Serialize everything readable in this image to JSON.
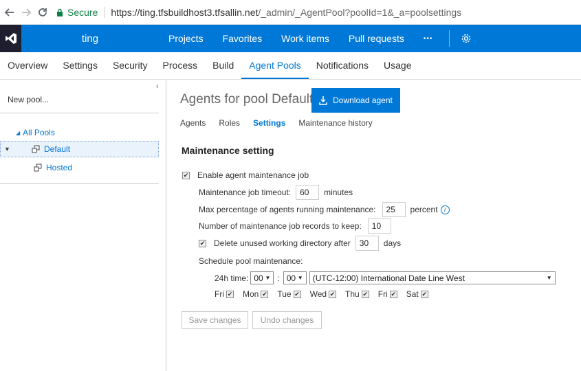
{
  "browser": {
    "secure_label": "Secure",
    "url_host": "https://ting.tfsbuildhost3.tfsallin.net",
    "url_path": "/_admin/_AgentPool?poolId=1&_a=poolsettings"
  },
  "topnav": {
    "project": "ting",
    "items": [
      "Projects",
      "Favorites",
      "Work items",
      "Pull requests",
      "•••"
    ]
  },
  "admin_tabs": [
    "Overview",
    "Settings",
    "Security",
    "Process",
    "Build",
    "Agent Pools",
    "Notifications",
    "Usage"
  ],
  "left": {
    "new_pool": "New pool...",
    "all_pools": "All Pools",
    "pools": [
      "Default",
      "Hosted"
    ]
  },
  "main": {
    "title": "Agents for pool Default",
    "download_label": "Download agent",
    "subtabs": [
      "Agents",
      "Roles",
      "Settings",
      "Maintenance history"
    ],
    "section_title": "Maintenance setting",
    "enable_label": "Enable agent maintenance job",
    "timeout_label": "Maintenance job timeout:",
    "timeout_value": "60",
    "timeout_unit": "minutes",
    "maxpct_label": "Max percentage of agents running maintenance:",
    "maxpct_value": "25",
    "maxpct_unit": "percent",
    "records_label": "Number of maintenance job records to keep:",
    "records_value": "10",
    "delete_label": "Delete unused working directory after",
    "delete_value": "30",
    "delete_unit": "days",
    "schedule_label": "Schedule pool maintenance:",
    "time_label": "24h time:",
    "hour": "00",
    "colon": ":",
    "minute": "00",
    "timezone": "(UTC-12:00) International Date Line West",
    "days": [
      "Fri",
      "Mon",
      "Tue",
      "Wed",
      "Thu",
      "Fri",
      "Sat"
    ],
    "save_label": "Save changes",
    "undo_label": "Undo changes"
  },
  "colors": {
    "accent": "#0078d7",
    "logo_bg": "#1e1e2e"
  }
}
